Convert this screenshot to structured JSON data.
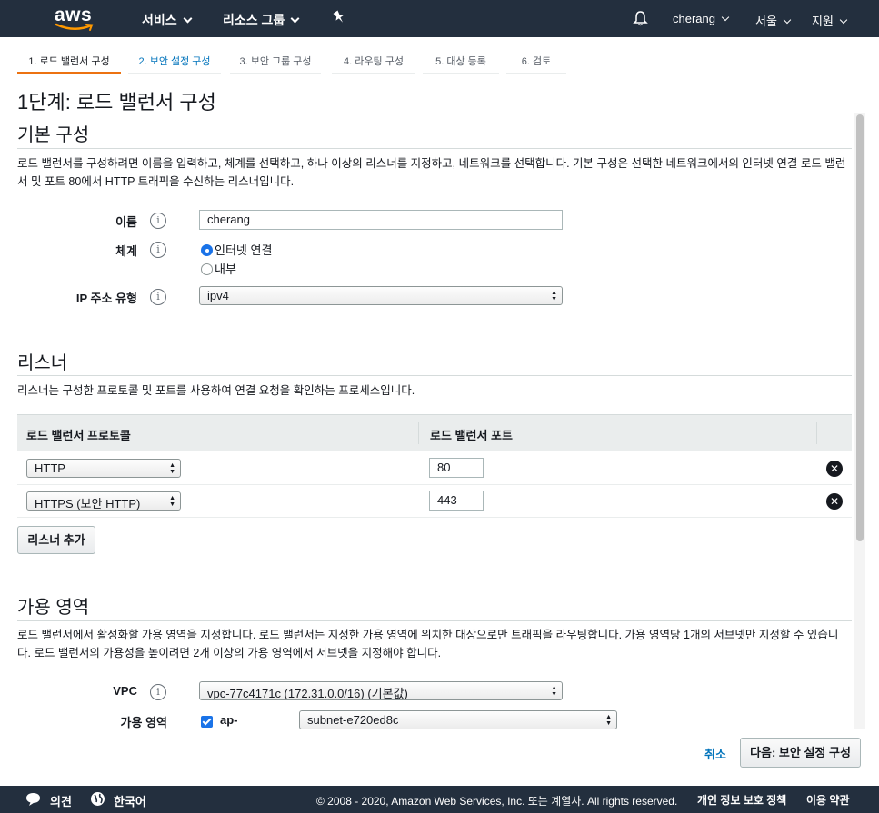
{
  "nav": {
    "logo": "aws",
    "services": "서비스",
    "resource_groups": "리소스 그룹",
    "user": "cherang",
    "region": "서울",
    "support": "지원"
  },
  "tabs": [
    {
      "label": "1. 로드 밸런서 구성"
    },
    {
      "label": "2. 보안 설정 구성"
    },
    {
      "label": "3. 보안 그룹 구성"
    },
    {
      "label": "4. 라우팅 구성"
    },
    {
      "label": "5. 대상 등록"
    },
    {
      "label": "6. 검토"
    }
  ],
  "page_title": "1단계: 로드 밸런서 구성",
  "basic": {
    "title": "기본 구성",
    "desc": "로드 밸런서를 구성하려면 이름을 입력하고, 체계를 선택하고, 하나 이상의 리스너를 지정하고, 네트워크를 선택합니다. 기본 구성은 선택한 네트워크에서의 인터넷 연결 로드 밸런서 및 포트 80에서 HTTP 트래픽을 수신하는 리스너입니다.",
    "name_label": "이름",
    "name_value": "cherang",
    "scheme_label": "체계",
    "scheme_options": [
      "인터넷 연결",
      "내부"
    ],
    "ip_label": "IP 주소 유형",
    "ip_value": "ipv4",
    "info": "i"
  },
  "listeners": {
    "title": "리스너",
    "desc": "리스너는 구성한 프로토콜 및 포트를 사용하여 연결 요청을 확인하는 프로세스입니다.",
    "col_protocol": "로드 밸런서 프로토콜",
    "col_port": "로드 밸런서 포트",
    "rows": [
      {
        "protocol": "HTTP",
        "port": "80"
      },
      {
        "protocol": "HTTPS (보안 HTTP)",
        "port": "443"
      }
    ],
    "remove": "✕",
    "add_button": "리스너 추가"
  },
  "az": {
    "title": "가용 영역",
    "desc": "로드 밸런서에서 활성화할 가용 영역을 지정합니다. 로드 밸런서는 지정한 가용 영역에 위치한 대상으로만 트래픽을 라우팅합니다. 가용 영역당 1개의 서브넷만 지정할 수 있습니다. 로드 밸런서의 가용성을 높이려면 2개 이상의 가용 영역에서 서브넷을 지정해야 합니다.",
    "vpc_label": "VPC",
    "vpc_value": "vpc-77c4171c (172.31.0.0/16) (기본값)",
    "zone_label": "가용 영역",
    "zone_name": "ap-",
    "subnet_value": "subnet-e720ed8c"
  },
  "actions": {
    "cancel": "취소",
    "next": "다음: 보안 설정 구성"
  },
  "footer": {
    "feedback": "의견",
    "language": "한국어",
    "copyright": "© 2008 - 2020, Amazon Web Services, Inc. 또는 계열사. All rights reserved.",
    "privacy": "개인 정보 보호 정책",
    "terms": "이용 약관"
  },
  "colors": {
    "nav_bg": "#232f3e",
    "accent": "#ec7211",
    "link": "#0073bb",
    "radio": "#1a73e8"
  }
}
